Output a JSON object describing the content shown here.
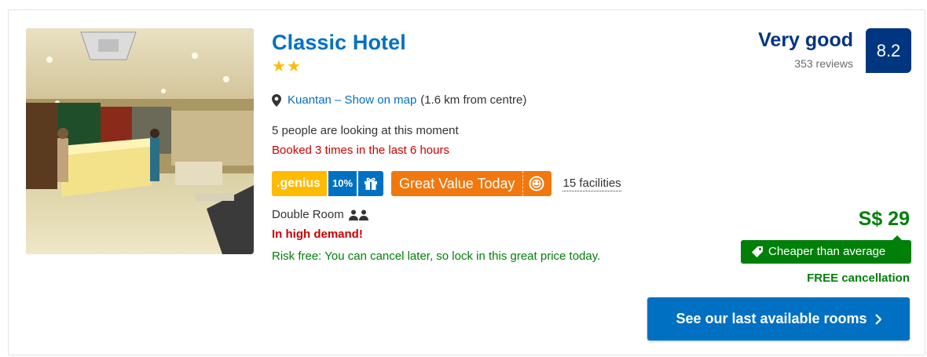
{
  "hotel": {
    "name": "Classic Hotel",
    "stars": 2,
    "location_link": "Kuantan – Show on map",
    "distance": "(1.6 km from centre)",
    "looking": "5 people are looking at this moment",
    "booked": "Booked 3 times in the last 6 hours",
    "facilities": "15 facilities"
  },
  "badges": {
    "genius": ".genius",
    "discount": "10%",
    "value": "Great Value Today"
  },
  "room": {
    "type": "Double Room",
    "demand": "In high demand!",
    "risk_free": "Risk free: You can cancel later, so lock in this great price today."
  },
  "review": {
    "word": "Very good",
    "count": "353 reviews",
    "score": "8.2"
  },
  "price": {
    "amount": "S$ 29",
    "cheaper": "Cheaper than average",
    "free_cancel": "FREE cancellation"
  },
  "cta": {
    "label": "See our last available rooms"
  },
  "icons": [
    "map-pin-icon",
    "gift-icon",
    "smiley-icon",
    "persons-icon",
    "tag-icon",
    "chevron-right-icon"
  ],
  "colors": {
    "brand_blue": "#0071c2",
    "dark_blue": "#003580",
    "green": "#008009",
    "red": "#cc0000",
    "genius_yellow": "#febb02",
    "orange": "#f0780f"
  }
}
